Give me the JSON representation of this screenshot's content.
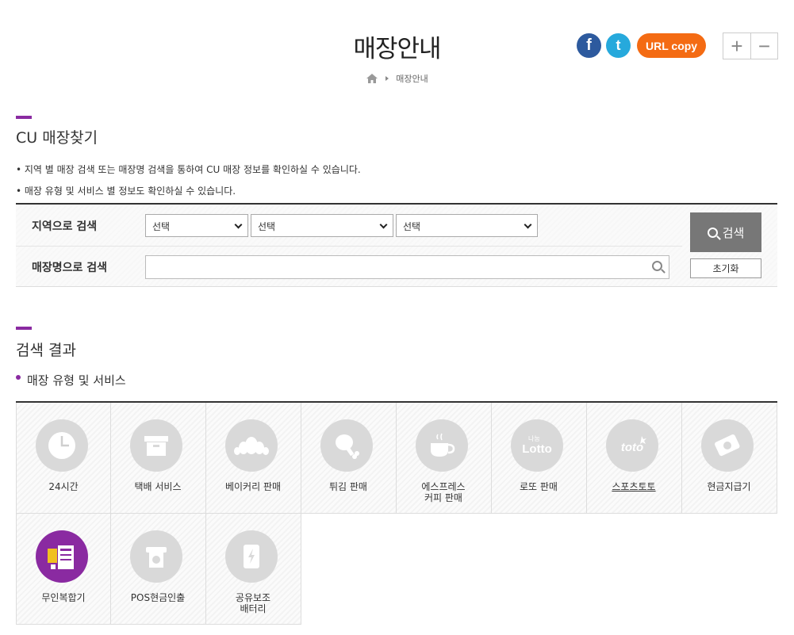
{
  "header": {
    "title": "매장안내",
    "breadcrumb_current": "매장안내",
    "share": {
      "facebook_glyph": "f",
      "twitter_glyph": "t",
      "url_copy_label": "URL copy"
    },
    "zoom": {
      "in_label": "+",
      "out_label": "−"
    }
  },
  "find": {
    "title": "CU 매장찾기",
    "info": [
      "• 지역 별 매장 검색 또는 매장명 검색을 통하여 CU 매장 정보를 확인하실 수 있습니다.",
      "• 매장 유형 및 서비스 별 정보도 확인하실 수 있습니다."
    ],
    "region_label": "지역으로 검색",
    "name_label": "매장명으로 검색",
    "selects": [
      "선택",
      "선택",
      "선택"
    ],
    "name_input_value": "",
    "search_label": "검색",
    "reset_label": "초기화"
  },
  "results": {
    "title": "검색 결과",
    "subtitle": "매장 유형 및 서비스"
  },
  "services": [
    {
      "label": "24시간",
      "icon": "clock-icon"
    },
    {
      "label": "택배 서비스",
      "icon": "box-icon"
    },
    {
      "label": "베이커리 판매",
      "icon": "croissant-icon"
    },
    {
      "label": "튀김 판매",
      "icon": "drumstick-icon"
    },
    {
      "label": "에스프레스\n커피 판매",
      "icon": "coffee-cup-icon"
    },
    {
      "label": "로또 판매",
      "icon": "lotto-icon",
      "icon_text": "Lotto",
      "icon_small": "나눔"
    },
    {
      "label": "스포츠토토",
      "icon": "toto-icon",
      "icon_text": "toto"
    },
    {
      "label": "현금지급기",
      "icon": "cash-card-icon"
    },
    {
      "label": "무인복합기",
      "icon": "copier-icon"
    },
    {
      "label": "POS현금인출",
      "icon": "pos-cash-icon"
    },
    {
      "label": "공유보조\n배터리",
      "icon": "battery-icon"
    }
  ],
  "colors": {
    "accent": "#8a2aa1",
    "facebook": "#2d5a9e",
    "twitter": "#26a9dc",
    "url_copy": "#f46b13",
    "search_button": "#777777",
    "icon_bg": "#d9d9d9"
  }
}
